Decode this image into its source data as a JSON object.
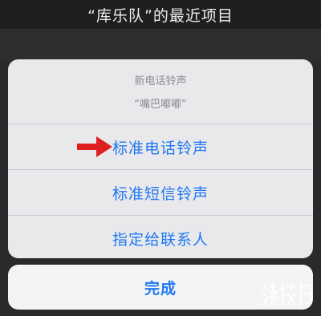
{
  "header": {
    "title": "“库乐队”的最近项目"
  },
  "sheet": {
    "title": "新电话铃声",
    "subtitle": "“嘴巴嘟嘟”",
    "options": [
      {
        "label": "标准电话铃声"
      },
      {
        "label": "标准短信铃声"
      },
      {
        "label": "指定给联系人"
      }
    ]
  },
  "done_label": "完成",
  "colors": {
    "accent": "#1f78f2",
    "arrow": "#e02020",
    "sheet_bg": "#e9e9ec",
    "backdrop": "#2a2a2c"
  },
  "icons": {
    "arrow": "red-arrow-icon",
    "watermark": "site-logo-watermark"
  }
}
